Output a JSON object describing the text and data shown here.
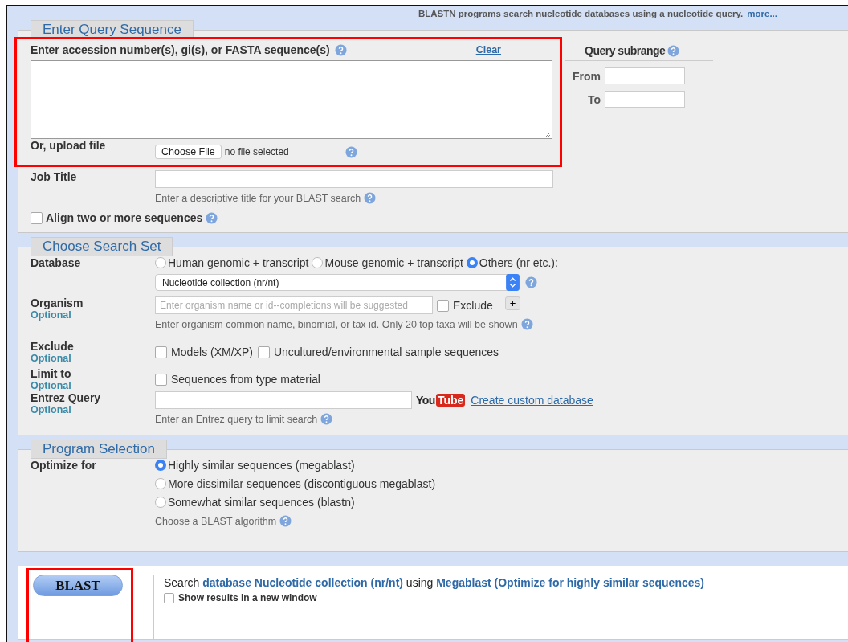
{
  "intro": {
    "text": "BLASTN programs search nucleotide databases using a nucleotide query.",
    "link": "more..."
  },
  "query_section": {
    "legend": "Enter Query Sequence",
    "highlighted": true,
    "query_label": "Enter accession number(s), gi(s), or FASTA sequence(s)",
    "clear_link": "Clear",
    "upload_label": "Or, upload file",
    "file_button": "Choose File",
    "file_status": "no file selected",
    "job_title_label": "Job Title",
    "job_title_hint": "Enter a descriptive title for your BLAST search",
    "align": {
      "label": "Align two or more sequences",
      "checked": false
    },
    "subrange": {
      "title": "Query subrange",
      "from_label": "From",
      "to_label": "To"
    }
  },
  "search_set": {
    "legend": "Choose Search Set",
    "database": {
      "label": "Database",
      "options": [
        {
          "label": "Human genomic + transcript",
          "selected": false
        },
        {
          "label": "Mouse genomic + transcript",
          "selected": false
        },
        {
          "label": "Others (nr etc.):",
          "selected": true
        }
      ],
      "select_value": "Nucleotide collection (nr/nt)"
    },
    "organism": {
      "label": "Organism",
      "optional": "Optional",
      "placeholder": "Enter organism name or id--completions will be suggested",
      "exclude": {
        "label": "Exclude",
        "checked": false
      },
      "add_button": "+",
      "hint": "Enter organism common name, binomial, or tax id. Only 20 top taxa will be shown"
    },
    "exclude": {
      "label": "Exclude",
      "optional": "Optional",
      "options": [
        {
          "label": "Models (XM/XP)",
          "checked": false
        },
        {
          "label": "Uncultured/environmental sample sequences",
          "checked": false
        }
      ]
    },
    "limit": {
      "label": "Limit to",
      "optional": "Optional",
      "options": [
        {
          "label": "Sequences from type material",
          "checked": false
        }
      ]
    },
    "entrez": {
      "label": "Entrez Query",
      "optional": "Optional",
      "logo_you": "You",
      "logo_tube": "Tube",
      "link": "Create custom database",
      "hint": "Enter an Entrez query to limit search"
    }
  },
  "program": {
    "legend": "Program Selection",
    "label": "Optimize for",
    "options": [
      {
        "label": "Highly similar sequences (megablast)",
        "selected": true
      },
      {
        "label": "More dissimilar sequences (discontiguous megablast)",
        "selected": false
      },
      {
        "label": "Somewhat similar sequences (blastn)",
        "selected": false
      }
    ],
    "hint": "Choose a BLAST algorithm"
  },
  "submit": {
    "button": "BLAST",
    "highlighted": true,
    "summary": "Search **database Nucleotide collection (nr/nt)** using **Megablast (Optimize for highly similar sequences)**",
    "new_window": {
      "label": "Show results in a new window",
      "checked": false
    }
  }
}
